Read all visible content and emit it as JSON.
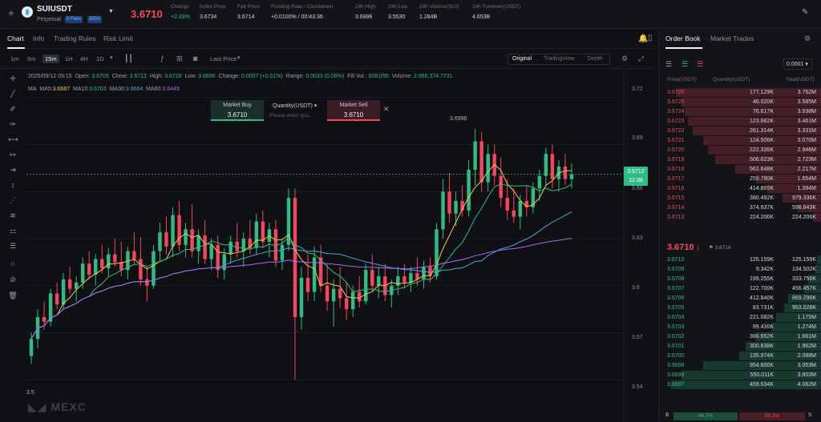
{
  "header": {
    "symbol": "SUIUSDT",
    "contract_type": "Perpetual",
    "badge_fees": "0 Fees",
    "badge_leverage": "300X",
    "last_price": "3.6710",
    "stats": [
      {
        "label": "Change",
        "value": "+2.33%"
      },
      {
        "label": "Index Price",
        "value": "3.6734"
      },
      {
        "label": "Fair Price",
        "value": "3.6714"
      },
      {
        "label": "Funding Rate / Countdown",
        "value": "+0.0100% / 00:43:36"
      },
      {
        "label": "24h High",
        "value": "3.6996"
      },
      {
        "label": "24h Low",
        "value": "3.5530"
      },
      {
        "label": "24h Volume(SUI)",
        "value": "1.284B"
      },
      {
        "label": "24h Turnover(USDT)",
        "value": "4.653B"
      }
    ]
  },
  "chart_tabs": [
    "Chart",
    "Info",
    "Trading Rules",
    "Risk Limit"
  ],
  "timeframes": [
    "1m",
    "5m",
    "15m",
    "1H",
    "4H",
    "1D"
  ],
  "active_timeframe": "15m",
  "price_source": "Last Price",
  "views": [
    "Original",
    "TradingView",
    "Depth"
  ],
  "active_view": "Original",
  "ohlc": {
    "date": "2025/09/12 09:15",
    "open_label": "Open:",
    "open": "3.6705",
    "close_label": "Close:",
    "close": "3.6712",
    "high_label": "High:",
    "high": "3.6729",
    "low_label": "Low:",
    "low": "3.6696",
    "change_label": "Change:",
    "change": "0.0007 (+0.01%)",
    "range_label": "Range:",
    "range": "0.0033 (0.08%)",
    "fillvol_label": "Fill Vol.:",
    "fillvol": "808,095",
    "volume_label": "Volume:",
    "volume": "2,966,374.7731"
  },
  "ma_line": {
    "label": "MA",
    "ma5_label": "MA5:",
    "ma5": "3.6687",
    "ma10_label": "MA10:",
    "ma10": "3.6703",
    "ma30_label": "MA30:",
    "ma30": "3.6664",
    "ma60_label": "MA60:",
    "ma60": "3.6449"
  },
  "quick_order": {
    "buy_label": "Market Buy",
    "buy_price": "3.6710",
    "qty_label": "Quantity(USDT)",
    "qty_placeholder": "Please enter qua...",
    "sell_label": "Market Sell",
    "sell_price": "3.6710"
  },
  "chart_overlay": {
    "high_marker": "3.6996",
    "low_marker": "3.5",
    "price_tag": "3.6712",
    "countdown": "12:38",
    "watermark": "MEXC"
  },
  "chart_data": {
    "type": "candlestick",
    "y_ticks": [
      "3.72",
      "3.69",
      "3.66",
      "3.63",
      "3.6",
      "3.57",
      "3.54"
    ],
    "ylim": [
      3.535,
      3.725
    ],
    "candles": [
      [
        3.555,
        3.57,
        3.55,
        3.566
      ],
      [
        3.566,
        3.585,
        3.56,
        3.58
      ],
      [
        3.58,
        3.59,
        3.572,
        3.577
      ],
      [
        3.577,
        3.598,
        3.574,
        3.595
      ],
      [
        3.595,
        3.602,
        3.585,
        3.588
      ],
      [
        3.588,
        3.608,
        3.585,
        3.604
      ],
      [
        3.604,
        3.612,
        3.595,
        3.598
      ],
      [
        3.598,
        3.606,
        3.59,
        3.602
      ],
      [
        3.602,
        3.618,
        3.598,
        3.614
      ],
      [
        3.614,
        3.622,
        3.604,
        3.607
      ],
      [
        3.607,
        3.62,
        3.6,
        3.617
      ],
      [
        3.617,
        3.626,
        3.608,
        3.611
      ],
      [
        3.611,
        3.624,
        3.606,
        3.62
      ],
      [
        3.62,
        3.63,
        3.612,
        3.615
      ],
      [
        3.615,
        3.628,
        3.606,
        3.61
      ],
      [
        3.61,
        3.625,
        3.604,
        3.622
      ],
      [
        3.622,
        3.634,
        3.614,
        3.617
      ],
      [
        3.617,
        3.631,
        3.6,
        3.604
      ],
      [
        3.604,
        3.612,
        3.59,
        3.6
      ],
      [
        3.6,
        3.626,
        3.598,
        3.622
      ],
      [
        3.622,
        3.64,
        3.616,
        3.634
      ],
      [
        3.634,
        3.644,
        3.62,
        3.625
      ],
      [
        3.625,
        3.65,
        3.618,
        3.645
      ],
      [
        3.645,
        3.654,
        3.622,
        3.626
      ],
      [
        3.626,
        3.64,
        3.618,
        3.636
      ],
      [
        3.636,
        3.652,
        3.618,
        3.622
      ],
      [
        3.622,
        3.636,
        3.614,
        3.632
      ],
      [
        3.632,
        3.642,
        3.614,
        3.617
      ],
      [
        3.617,
        3.63,
        3.61,
        3.626
      ],
      [
        3.626,
        3.632,
        3.605,
        3.61
      ],
      [
        3.61,
        3.624,
        3.604,
        3.62
      ],
      [
        3.62,
        3.632,
        3.614,
        3.628
      ],
      [
        3.628,
        3.64,
        3.618,
        3.622
      ],
      [
        3.622,
        3.634,
        3.612,
        3.63
      ],
      [
        3.63,
        3.642,
        3.62,
        3.624
      ],
      [
        3.624,
        3.646,
        3.62,
        3.641
      ],
      [
        3.641,
        3.648,
        3.624,
        3.628
      ],
      [
        3.628,
        3.64,
        3.618,
        3.636
      ],
      [
        3.636,
        3.642,
        3.612,
        3.616
      ],
      [
        3.616,
        3.63,
        3.61,
        3.626
      ],
      [
        3.626,
        3.662,
        3.622,
        3.656
      ],
      [
        3.656,
        3.662,
        3.54,
        3.58
      ],
      [
        3.58,
        3.612,
        3.572,
        3.605
      ],
      [
        3.605,
        3.62,
        3.59,
        3.596
      ],
      [
        3.596,
        3.625,
        3.59,
        3.618
      ],
      [
        3.618,
        3.626,
        3.596,
        3.6
      ],
      [
        3.6,
        3.614,
        3.584,
        3.59
      ],
      [
        3.59,
        3.604,
        3.574,
        3.598
      ],
      [
        3.598,
        3.612,
        3.586,
        3.592
      ],
      [
        3.592,
        3.602,
        3.578,
        3.585
      ],
      [
        3.585,
        3.6,
        3.58,
        3.596
      ],
      [
        3.596,
        3.606,
        3.586,
        3.59
      ],
      [
        3.59,
        3.614,
        3.588,
        3.61
      ],
      [
        3.61,
        3.62,
        3.596,
        3.6
      ],
      [
        3.6,
        3.612,
        3.592,
        3.606
      ],
      [
        3.606,
        3.614,
        3.59,
        3.594
      ],
      [
        3.594,
        3.604,
        3.586,
        3.6
      ],
      [
        3.6,
        3.612,
        3.594,
        3.606
      ],
      [
        3.606,
        3.614,
        3.598,
        3.602
      ],
      [
        3.602,
        3.612,
        3.596,
        3.608
      ],
      [
        3.608,
        3.618,
        3.6,
        3.604
      ],
      [
        3.604,
        3.616,
        3.598,
        3.612
      ],
      [
        3.612,
        3.618,
        3.602,
        3.606
      ],
      [
        3.606,
        3.64,
        3.604,
        3.636
      ],
      [
        3.636,
        3.668,
        3.63,
        3.66
      ],
      [
        3.66,
        3.672,
        3.64,
        3.646
      ],
      [
        3.646,
        3.66,
        3.638,
        3.654
      ],
      [
        3.654,
        3.664,
        3.644,
        3.648
      ],
      [
        3.648,
        3.68,
        3.644,
        3.674
      ],
      [
        3.674,
        3.7,
        3.664,
        3.692
      ],
      [
        3.692,
        3.698,
        3.66,
        3.666
      ],
      [
        3.666,
        3.69,
        3.66,
        3.684
      ],
      [
        3.684,
        3.69,
        3.664,
        3.67
      ],
      [
        3.67,
        3.682,
        3.65,
        3.656
      ],
      [
        3.656,
        3.668,
        3.642,
        3.648
      ],
      [
        3.648,
        3.662,
        3.64,
        3.644
      ],
      [
        3.644,
        3.658,
        3.636,
        3.654
      ],
      [
        3.654,
        3.664,
        3.644,
        3.65
      ],
      [
        3.65,
        3.666,
        3.646,
        3.662
      ],
      [
        3.662,
        3.674,
        3.654,
        3.67
      ],
      [
        3.67,
        3.688,
        3.664,
        3.684
      ],
      [
        3.684,
        3.69,
        3.662,
        3.668
      ],
      [
        3.668,
        3.68,
        3.66,
        3.676
      ],
      [
        3.676,
        3.684,
        3.664,
        3.668
      ],
      [
        3.668,
        3.678,
        3.662,
        3.671
      ]
    ]
  },
  "orderbook": {
    "tabs": [
      "Order Book",
      "Market Trades"
    ],
    "precision": "0.0001",
    "head": [
      "Price(USDT)",
      "Quantity(USDT)",
      "Total(USDT)"
    ],
    "asks": [
      [
        "3.6726",
        "177.129K",
        "3.762M",
        0.96
      ],
      [
        "3.6725",
        "46.020K",
        "3.585M",
        0.92
      ],
      [
        "3.6724",
        "76.617K",
        "3.538M",
        0.9
      ],
      [
        "3.6723",
        "123.662K",
        "3.461M",
        0.88
      ],
      [
        "3.6722",
        "261.314K",
        "3.331M",
        0.85
      ],
      [
        "3.6721",
        "124.506K",
        "3.070M",
        0.78
      ],
      [
        "3.6720",
        "222.336K",
        "2.946M",
        0.75
      ],
      [
        "3.6719",
        "506.623K",
        "2.723M",
        0.7
      ],
      [
        "3.6718",
        "562.648K",
        "2.217M",
        0.57
      ],
      [
        "3.6717",
        "259.790K",
        "1.654M",
        0.43
      ],
      [
        "3.6716",
        "414.865K",
        "1.394M",
        0.36
      ],
      [
        "3.6715",
        "380.492K",
        "979.336K",
        0.26
      ],
      [
        "3.6714",
        "374.637K",
        "598.843K",
        0.16
      ],
      [
        "3.6713",
        "224.206K",
        "224.206K",
        0.06
      ]
    ],
    "mid_price": "3.6710",
    "mid_arrow": "↓",
    "mark_price": "3.6714",
    "bids": [
      [
        "3.6710",
        "125.159K",
        "125.159K",
        0.03
      ],
      [
        "3.6709",
        "9.342K",
        "134.502K",
        0.04
      ],
      [
        "3.6708",
        "199.255K",
        "333.756K",
        0.09
      ],
      [
        "3.6707",
        "122.700K",
        "456.457K",
        0.12
      ],
      [
        "3.6706",
        "412.840K",
        "869.296K",
        0.22
      ],
      [
        "3.6705",
        "83.731K",
        "953.028K",
        0.25
      ],
      [
        "3.6704",
        "221.082K",
        "1.175M",
        0.3
      ],
      [
        "3.6703",
        "99.436K",
        "1.274M",
        0.33
      ],
      [
        "3.6702",
        "386.652K",
        "1.661M",
        0.43
      ],
      [
        "3.6701",
        "300.838K",
        "1.962M",
        0.5
      ],
      [
        "3.6700",
        "135.974K",
        "2.098M",
        0.54
      ],
      [
        "3.6699",
        "954.600K",
        "3.053M",
        0.78
      ],
      [
        "3.6698",
        "550.011K",
        "3.603M",
        0.92
      ],
      [
        "3.6697",
        "459.634K",
        "4.062M",
        0.99
      ]
    ],
    "ratio": {
      "buy_label": "B",
      "buy_pct": "44.7%",
      "sell_pct": "55.3%",
      "sell_label": "S"
    }
  },
  "colors": {
    "up": "#2ebd85",
    "down": "#f6465d",
    "ma5": "#f0c74a",
    "ma10": "#2ebd85",
    "ma30": "#4aa3df",
    "ma60": "#a66bf0"
  },
  "icons": [
    "star-icon",
    "dropdown-caret-icon",
    "pencil-icon",
    "bell-icon",
    "settings-icon",
    "crosshair-icon",
    "trend-line-icon",
    "magnet-icon",
    "eye-icon",
    "trash-icon",
    "camera-icon",
    "fullscreen-icon"
  ]
}
